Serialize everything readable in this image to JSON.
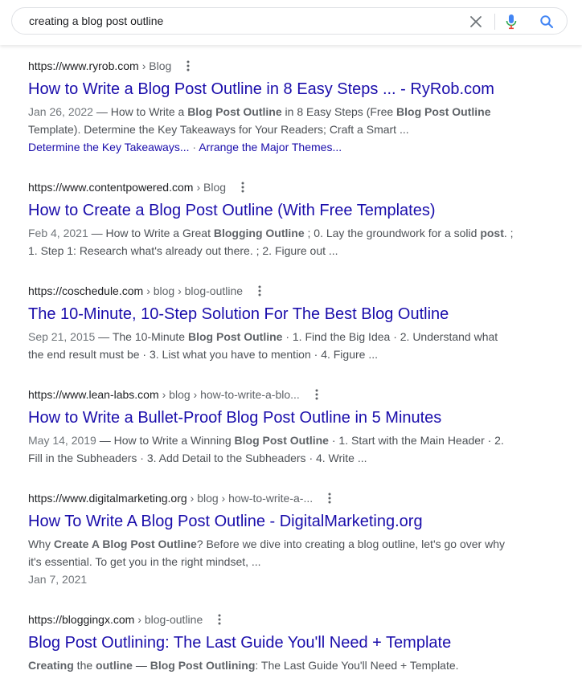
{
  "search": {
    "query": "creating a blog post outline"
  },
  "icons": {
    "clear": "close-icon",
    "mic": "microphone-icon",
    "search": "search-icon",
    "more": "more-vert-icon"
  },
  "colors": {
    "link": "#1a0dab",
    "snippet": "#4d5156",
    "mic_blue": "#4285f4",
    "mic_red": "#ea4335",
    "search_blue": "#4285f4"
  },
  "results": [
    {
      "domain": "https://www.ryrob.com",
      "path": "› Blog",
      "title": "How to Write a Blog Post Outline in 8 Easy Steps ... - RyRob.com",
      "date": "Jan 26, 2022",
      "dash": " — ",
      "s1": "How to Write a ",
      "b1": "Blog Post Outline",
      "s2": " in 8 Easy Steps (Free ",
      "b2": "Blog Post Outline",
      "s3": " Template). Determine the Key Takeaways for Your Readers; Craft a Smart ...",
      "sitelink1": "Determine the Key Takeaways...",
      "sitelink_sep": " · ",
      "sitelink2": "Arrange the Major Themes..."
    },
    {
      "domain": "https://www.contentpowered.com",
      "path": "› Blog",
      "title": "How to Create a Blog Post Outline (With Free Templates)",
      "date": "Feb 4, 2021",
      "dash": " — ",
      "s1": "How to Write a Great ",
      "b1": "Blogging Outline",
      "s2": " ; 0. Lay the groundwork for a solid ",
      "b2": "post",
      "s3": ". ; 1. Step 1: Research what's already out there. ; 2. Figure out ..."
    },
    {
      "domain": "https://coschedule.com",
      "path": "› blog › blog-outline",
      "title": "The 10-Minute, 10-Step Solution For The Best Blog Outline",
      "date": "Sep 21, 2015",
      "dash": " — ",
      "s1": "The 10-Minute ",
      "b1": "Blog Post Outline",
      "s2": " · 1. Find the Big Idea · 2. Understand what the end result must be · 3. List what you have to mention · 4. Figure ..."
    },
    {
      "domain": "https://www.lean-labs.com",
      "path": "› blog › how-to-write-a-blo...",
      "title": "How to Write a Bullet-Proof Blog Post Outline in 5 Minutes",
      "date": "May 14, 2019",
      "dash": " — ",
      "s1": "How to Write a Winning ",
      "b1": "Blog Post Outline",
      "s2": " · 1. Start with the Main Header · 2. Fill in the Subheaders · 3. Add Detail to the Subheaders · 4. Write ..."
    },
    {
      "domain": "https://www.digitalmarketing.org",
      "path": "› blog › how-to-write-a-...",
      "title": "How To Write A Blog Post Outline - DigitalMarketing.org",
      "s0": "Why ",
      "b1": "Create A Blog Post Outline",
      "s1": "? Before we dive into creating a blog outline, let's go over why it's essential. To get you in the right mindset, ...",
      "date": "Jan 7, 2021"
    },
    {
      "domain": "https://bloggingx.com",
      "path": "› blog-outline",
      "title": "Blog Post Outlining: The Last Guide You'll Need + Template",
      "b0": "Creating",
      "s1": " the ",
      "b1": "outline",
      "s2": " — ",
      "b2": "Blog Post Outlining",
      "s3": ": The Last Guide You'll Need + Template."
    }
  ]
}
